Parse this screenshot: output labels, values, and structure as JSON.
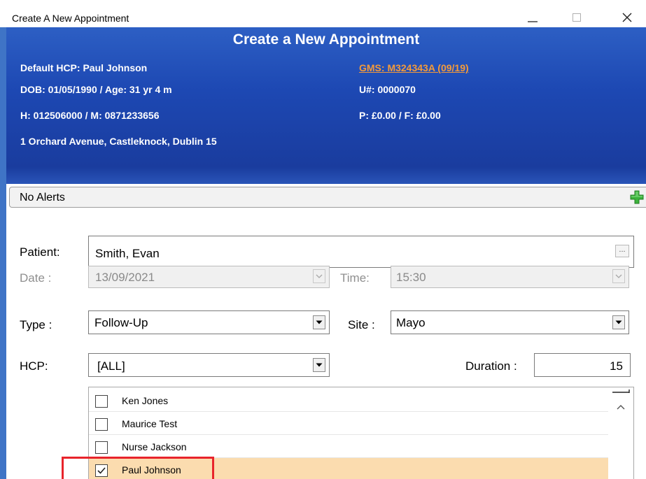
{
  "window": {
    "title": "Create A New Appointment",
    "controls": {
      "minimize_icon": "minimize-icon",
      "maximize_icon": "maximize-icon",
      "close_icon": "close-icon"
    }
  },
  "banner": {
    "title": "Create a New Appointment",
    "default_hcp": "Default HCP: Paul Johnson",
    "gms": "GMS: M324343A (09/19)",
    "dob_age": "DOB: 01/05/1990 / Age: 31 yr 4 m",
    "unumber": "U#: 0000070",
    "phones": "H: 012506000  / M: 0871233656",
    "payments": "P: £0.00 / F: £0.00",
    "address": "1 Orchard Avenue, Castleknock, Dublin 15",
    "colors": {
      "gradient_top": "#2d5fc4",
      "gradient_bottom": "#1a3c9e",
      "link": "#f39a3a"
    }
  },
  "alerts": {
    "label": "No Alerts",
    "add_icon": "green-plus-icon"
  },
  "form": {
    "patient_label": "Patient:",
    "patient_value": "Smith, Evan",
    "patient_browse": "...",
    "date_label": "Date :",
    "date_value": "13/09/2021",
    "time_label": "Time:",
    "time_value": "15:30",
    "type_label": "Type :",
    "type_value": "Follow-Up",
    "site_label": "Site :",
    "site_value": "Mayo",
    "hcp_label": "HCP:",
    "hcp_value": "[ALL]",
    "duration_label": "Duration :",
    "duration_value": "15"
  },
  "hcp_list": [
    {
      "name": "Ken Jones",
      "checked": false
    },
    {
      "name": "Maurice Test",
      "checked": false
    },
    {
      "name": "Nurse Jackson",
      "checked": false
    },
    {
      "name": "Paul Johnson",
      "checked": true
    }
  ],
  "highlight_color": "#e8242b",
  "selected_row_color": "#fbdcaf"
}
